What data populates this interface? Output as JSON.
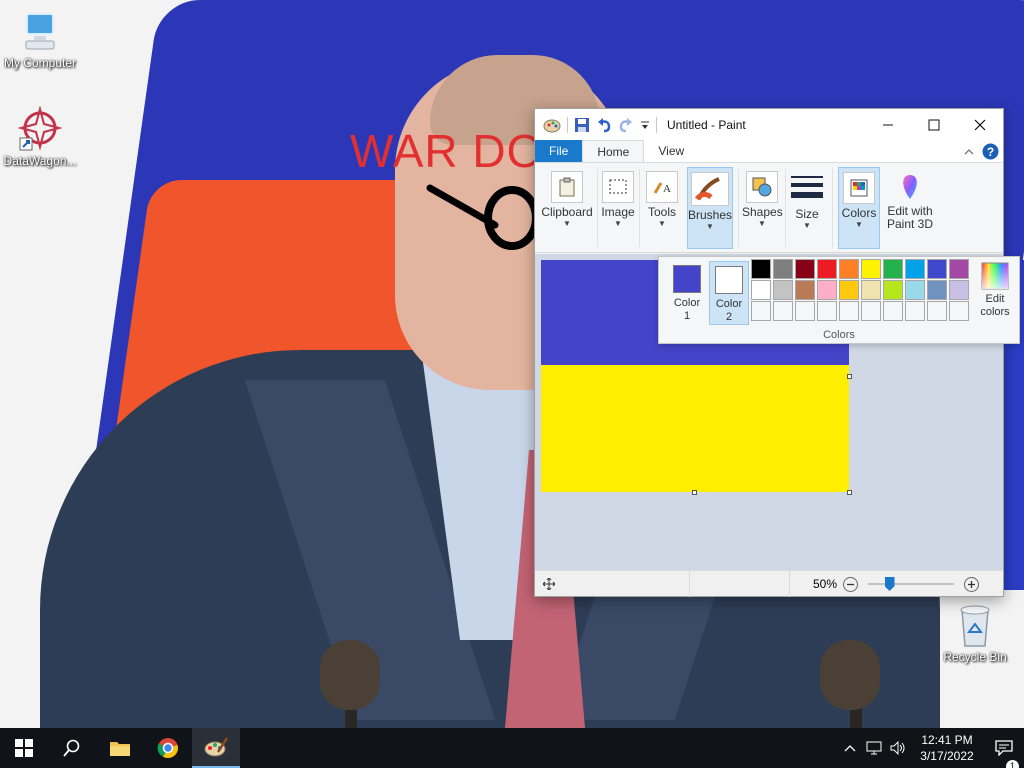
{
  "desktop": {
    "wallpaper_overlay_text": "WAR DO",
    "icons": [
      {
        "label": "My Computer",
        "icon": "computer-icon"
      },
      {
        "label": "DataWagon...",
        "icon": "datawagon-shortcut-icon"
      },
      {
        "label": "Recycle Bin",
        "icon": "recycle-bin-icon"
      }
    ]
  },
  "paint": {
    "title": "Untitled - Paint",
    "tabs": [
      {
        "label": "File"
      },
      {
        "label": "Home"
      },
      {
        "label": "View"
      }
    ],
    "groups": [
      {
        "label": "Clipboard",
        "icon": "clipboard-icon"
      },
      {
        "label": "Image",
        "icon": "select-icon"
      },
      {
        "label": "Tools",
        "icon": "tools-icon"
      },
      {
        "label": "Brushes",
        "icon": "brush-icon"
      },
      {
        "label": "Shapes",
        "icon": "shapes-icon"
      },
      {
        "label": "Size",
        "icon": "size-icon"
      },
      {
        "label": "Colors",
        "icon": "colors-icon"
      }
    ],
    "edit_3d_label_line1": "Edit with",
    "edit_3d_label_line2": "Paint 3D",
    "canvas": {
      "bands": [
        {
          "name": "blue",
          "color": "#4444c8"
        },
        {
          "name": "yellow",
          "color": "#ffee00"
        }
      ]
    },
    "status": {
      "zoom_label": "50%",
      "zoom_fraction": 0.25
    },
    "colors_panel": {
      "color1_label_line1": "Color",
      "color1_label_line2": "1",
      "color1_value": "#4444c8",
      "color2_label_line1": "Color",
      "color2_label_line2": "2",
      "color2_value": "#ffffff",
      "edit_colors_line1": "Edit",
      "edit_colors_line2": "colors",
      "caption": "Colors",
      "palette_rows": [
        [
          "#000000",
          "#7f7f7f",
          "#880015",
          "#ed1c24",
          "#ff7f27",
          "#fff200",
          "#22b14c",
          "#00a2e8",
          "#3f48cc",
          "#a349a4"
        ],
        [
          "#ffffff",
          "#c3c3c3",
          "#b97a57",
          "#ffaec9",
          "#ffc90e",
          "#efe4b0",
          "#b5e61d",
          "#99d9ea",
          "#7092be",
          "#c8bfe7"
        ],
        [
          "#f5f6f7",
          "#f5f6f7",
          "#f5f6f7",
          "#f5f6f7",
          "#f5f6f7",
          "#f5f6f7",
          "#f5f6f7",
          "#f5f6f7",
          "#f5f6f7",
          "#f5f6f7"
        ]
      ]
    }
  },
  "taskbar": {
    "apps": [
      {
        "name": "start",
        "icon": "windows-start-icon"
      },
      {
        "name": "search",
        "icon": "search-icon"
      },
      {
        "name": "explorer",
        "icon": "folder-icon"
      },
      {
        "name": "chrome",
        "icon": "chrome-icon"
      },
      {
        "name": "paint",
        "icon": "paint-icon"
      }
    ],
    "time": "12:41 PM",
    "date": "3/17/2022",
    "notification_count": "1"
  }
}
